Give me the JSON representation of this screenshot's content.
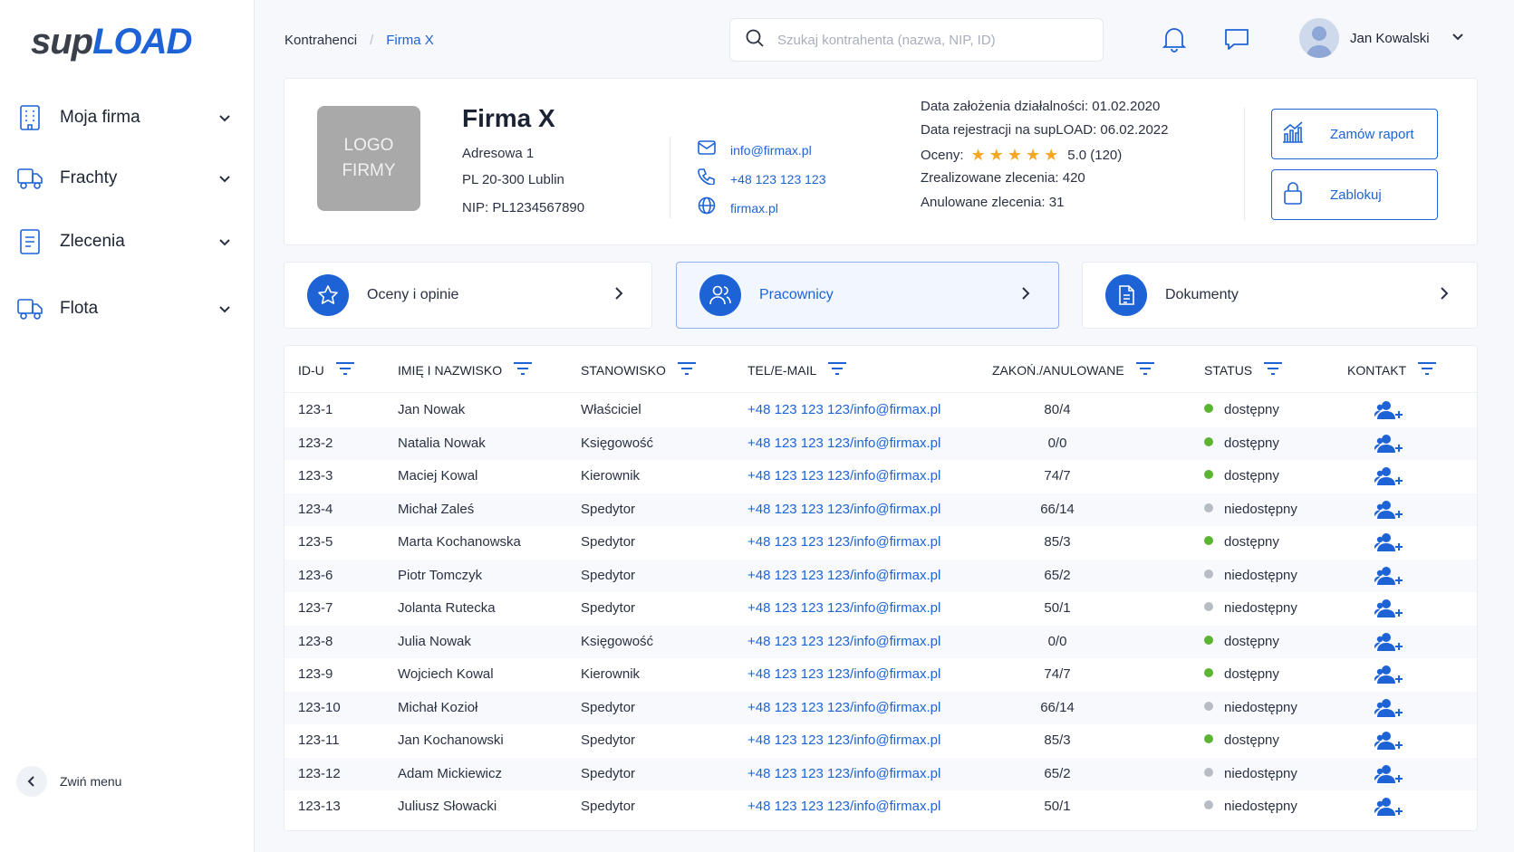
{
  "app": {
    "logo_sup": "sup",
    "logo_load": "LOAD"
  },
  "sidebar": {
    "items": [
      {
        "label": "Moja firma",
        "icon": "building-icon"
      },
      {
        "label": "Frachty",
        "icon": "truck-icon"
      },
      {
        "label": "Zlecenia",
        "icon": "document-icon"
      },
      {
        "label": "Flota",
        "icon": "truck-icon"
      }
    ],
    "collapse_label": "Zwiń menu"
  },
  "header": {
    "breadcrumb": [
      "Kontrahenci",
      "/",
      "Firma X"
    ],
    "search_placeholder": "Szukaj kontrahenta (nazwa, NIP, ID)",
    "user_name": "Jan Kowalski"
  },
  "company": {
    "logo_text_1": "LOGO",
    "logo_text_2": "FIRMY",
    "name": "Firma X",
    "address_1": "Adresowa 1",
    "address_2": "PL 20-300 Lublin",
    "nip": "NIP: PL1234567890",
    "email": "info@firmax.pl",
    "phone": "+48 123 123 123",
    "website": "firmax.pl",
    "founded": "Data założenia działalności:  01.02.2020",
    "registered": "Data rejestracji na supLOAD:  06.02.2022",
    "ratings_label": "Oceny:",
    "ratings_value": "5.0 (120)",
    "completed": "Zrealizowane zlecenia:  420",
    "cancelled": "Anulowane zlecenia:  31",
    "btn_report": "Zamów raport",
    "btn_block": "Zablokuj"
  },
  "tabs": [
    {
      "label": "Oceny i opinie",
      "icon": "star-icon"
    },
    {
      "label": "Pracownicy",
      "icon": "users-icon"
    },
    {
      "label": "Dokumenty",
      "icon": "document-icon"
    }
  ],
  "table": {
    "columns": [
      "ID-U",
      "IMIĘ I NAZWISKO",
      "STANOWISKO",
      "TEL/E-MAIL",
      "ZAKOŃ./ANULOWANE",
      "STATUS",
      "KONTAKT"
    ],
    "rows": [
      {
        "id": "123-1",
        "name": "Jan Nowak",
        "role": "Właściciel",
        "contact": "+48 123 123 123/info@firmax.pl",
        "ratio": "80/4",
        "status": "dostępny",
        "available": true
      },
      {
        "id": "123-2",
        "name": "Natalia Nowak",
        "role": "Księgowość",
        "contact": "+48 123 123 123/info@firmax.pl",
        "ratio": "0/0",
        "status": "dostępny",
        "available": true
      },
      {
        "id": "123-3",
        "name": "Maciej Kowal",
        "role": "Kierownik",
        "contact": "+48 123 123 123/info@firmax.pl",
        "ratio": "74/7",
        "status": "dostępny",
        "available": true
      },
      {
        "id": "123-4",
        "name": "Michał Zaleś",
        "role": "Spedytor",
        "contact": "+48 123 123 123/info@firmax.pl",
        "ratio": "66/14",
        "status": "niedostępny",
        "available": false
      },
      {
        "id": "123-5",
        "name": "Marta Kochanowska",
        "role": "Spedytor",
        "contact": "+48 123 123 123/info@firmax.pl",
        "ratio": "85/3",
        "status": "dostępny",
        "available": true
      },
      {
        "id": "123-6",
        "name": "Piotr Tomczyk",
        "role": "Spedytor",
        "contact": "+48 123 123 123/info@firmax.pl",
        "ratio": "65/2",
        "status": "niedostępny",
        "available": false
      },
      {
        "id": "123-7",
        "name": "Jolanta Rutecka",
        "role": "Spedytor",
        "contact": "+48 123 123 123/info@firmax.pl",
        "ratio": "50/1",
        "status": "niedostępny",
        "available": false
      },
      {
        "id": "123-8",
        "name": "Julia Nowak",
        "role": "Księgowość",
        "contact": "+48 123 123 123/info@firmax.pl",
        "ratio": "0/0",
        "status": "dostępny",
        "available": true
      },
      {
        "id": "123-9",
        "name": "Wojciech Kowal",
        "role": "Kierownik",
        "contact": "+48 123 123 123/info@firmax.pl",
        "ratio": "74/7",
        "status": "dostępny",
        "available": true
      },
      {
        "id": "123-10",
        "name": "Michał Kozioł",
        "role": "Spedytor",
        "contact": "+48 123 123 123/info@firmax.pl",
        "ratio": "66/14",
        "status": "niedostępny",
        "available": false
      },
      {
        "id": "123-11",
        "name": "Jan Kochanowski",
        "role": "Spedytor",
        "contact": "+48 123 123 123/info@firmax.pl",
        "ratio": "85/3",
        "status": "dostępny",
        "available": true
      },
      {
        "id": "123-12",
        "name": "Adam Mickiewicz",
        "role": "Spedytor",
        "contact": "+48 123 123 123/info@firmax.pl",
        "ratio": "65/2",
        "status": "niedostępny",
        "available": false
      },
      {
        "id": "123-13",
        "name": "Juliusz Słowacki",
        "role": "Spedytor",
        "contact": "+48 123 123 123/info@firmax.pl",
        "ratio": "50/1",
        "status": "niedostępny",
        "available": false
      }
    ]
  },
  "colors": {
    "accent": "#1e63d6",
    "status_available": "#5bb531",
    "status_unavailable": "#b8bcc4",
    "star": "#f5a623"
  }
}
